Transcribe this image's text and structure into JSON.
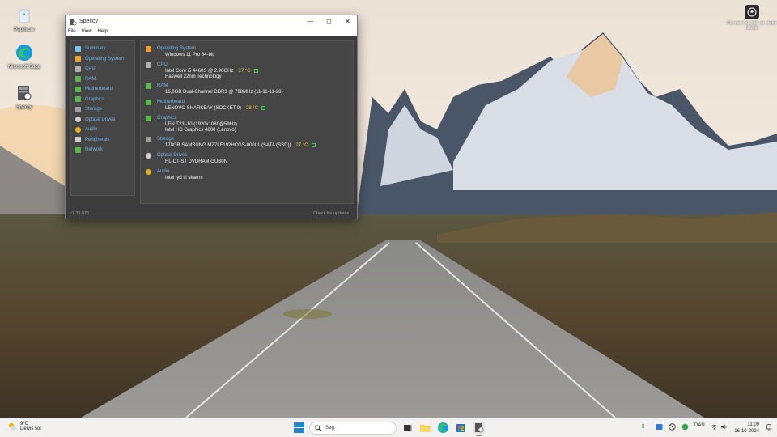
{
  "desktop": {
    "icons": [
      {
        "label": "Papirkurv",
        "icon": "recycle-bin-icon"
      },
      {
        "label": "Microsoft Edge",
        "icon": "edge-icon"
      },
      {
        "label": "Speccy",
        "icon": "speccy-icon"
      }
    ],
    "spotlight_label": "Få mere at vide om dette billede"
  },
  "window": {
    "title": "Speccy",
    "menu": [
      "File",
      "View",
      "Help"
    ],
    "nav": [
      {
        "label": "Summary",
        "color": "#7ec3f0"
      },
      {
        "label": "Operating System",
        "color": "#f0a030"
      },
      {
        "label": "CPU",
        "color": "#b0b0b0"
      },
      {
        "label": "RAM",
        "color": "#58b848"
      },
      {
        "label": "Motherboard",
        "color": "#58b848"
      },
      {
        "label": "Graphics",
        "color": "#58b848"
      },
      {
        "label": "Storage",
        "color": "#a0a0a0"
      },
      {
        "label": "Optical Drives",
        "color": "#d0d0d0"
      },
      {
        "label": "Audio",
        "color": "#e0b020"
      },
      {
        "label": "Peripherals",
        "color": "#d0d0d0"
      },
      {
        "label": "Network",
        "color": "#58b848"
      }
    ],
    "summary": {
      "os": {
        "header": "Operating System",
        "lines": [
          "Windows 11 Pro 64-bit"
        ]
      },
      "cpu": {
        "header": "CPU",
        "lines": [
          "Intel Core i5 4460S @ 2.90GHz",
          "Haswell 22nm Technology"
        ],
        "temp": "27 °C"
      },
      "ram": {
        "header": "RAM",
        "lines": [
          "16,0GB Dual-Channel DDR3 @ 798MHz (11-11-11-28)"
        ]
      },
      "motherboard": {
        "header": "Motherboard",
        "lines": [
          "LENOVO SHARKBAY (SOCKET 0)"
        ],
        "temp": "28 °C"
      },
      "graphics": {
        "header": "Graphics",
        "lines": [
          "LEN T23i-10 (1920x1080@59Hz)",
          "Intel HD Graphics 4600 (Lenovo)"
        ]
      },
      "storage": {
        "header": "Storage",
        "lines": [
          "178GB SAMSUNG MZ7LF192HCGS-000L1 (SATA (SSD))"
        ],
        "temp": "27 °C"
      },
      "optical": {
        "header": "Optical Drives",
        "lines": [
          "HL-DT-ST DVDRAM GUB0N"
        ]
      },
      "audio": {
        "header": "Audio",
        "lines": [
          "Intel lyd til skærm"
        ]
      }
    },
    "status": {
      "version": "v1.33.075",
      "update": "Check for updates..."
    }
  },
  "taskbar": {
    "weather": {
      "temp": "9°C",
      "desc": "Delvis sol"
    },
    "search_placeholder": "Søg",
    "language": "DAN",
    "time": "11:09",
    "date": "16-10-2024"
  },
  "colors": {
    "accent": "#6fb3e8",
    "temp": "#e8c848",
    "window_bg": "#3c3c3c"
  }
}
